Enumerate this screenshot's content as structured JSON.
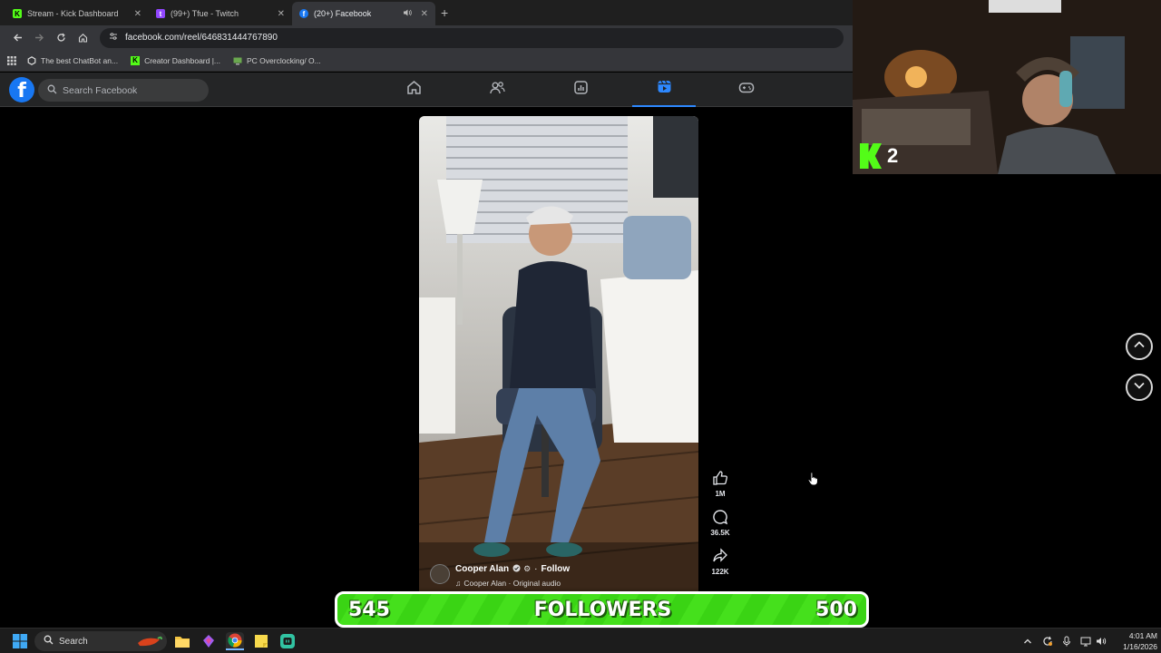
{
  "browser": {
    "tabs": [
      {
        "label": "Stream - Kick Dashboard",
        "favicon": "kick-icon",
        "active": false
      },
      {
        "label": "(99+) Tfue - Twitch",
        "favicon": "twitch-icon",
        "active": false
      },
      {
        "label": "(20+) Facebook",
        "favicon": "facebook-icon",
        "active": true
      }
    ],
    "new_tab": "+",
    "close_glyph": "✕",
    "url": "facebook.com/reel/646831444767890",
    "bookmarks": [
      {
        "label": "The best ChatBot an...",
        "icon": "openai-icon"
      },
      {
        "label": "Creator Dashboard |...",
        "icon": "kick-icon"
      },
      {
        "label": "PC Overclocking/ O...",
        "icon": "pc-icon"
      }
    ]
  },
  "facebook": {
    "logo": "f",
    "search_placeholder": "Search Facebook",
    "nav": [
      "home-icon",
      "friends-icon",
      "dashboard-icon",
      "video-icon",
      "gaming-icon"
    ],
    "active_nav": "video-icon",
    "accent": "#1877f2"
  },
  "reel": {
    "likes": "1M",
    "comments": "36.5K",
    "shares": "122K",
    "creator_name": "Cooper Alan",
    "follow_label": "Follow",
    "separator": "·",
    "audio": "Cooper Alan · Original audio"
  },
  "stream_overlay": {
    "kick_count": "2",
    "followers_current": "545",
    "followers_label": "FOLLOWERS",
    "followers_goal": "500",
    "kick_color": "#53fc18"
  },
  "taskbar": {
    "search_label": "Search",
    "time": "4:01 AM",
    "date": "1/16/2026"
  }
}
